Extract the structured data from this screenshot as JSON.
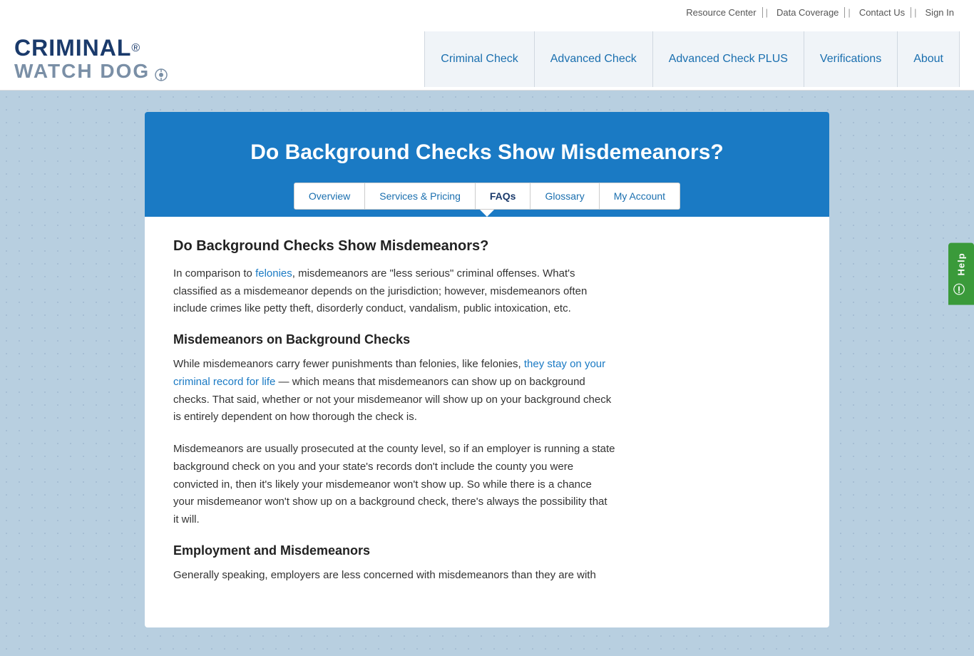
{
  "header": {
    "logo_criminal": "CRIMINAL",
    "logo_reg": "®",
    "logo_watchdog": "WATCH DOG",
    "top_links": [
      {
        "label": "Resource Center",
        "id": "resource-center"
      },
      {
        "label": "Data Coverage",
        "id": "data-coverage"
      },
      {
        "label": "Contact Us",
        "id": "contact-us"
      },
      {
        "label": "Sign In",
        "id": "sign-in"
      }
    ],
    "nav_items": [
      {
        "label": "Criminal Check",
        "id": "nav-criminal-check"
      },
      {
        "label": "Advanced Check",
        "id": "nav-advanced-check"
      },
      {
        "label": "Advanced Check PLUS",
        "id": "nav-advanced-check-plus"
      },
      {
        "label": "Verifications",
        "id": "nav-verifications"
      },
      {
        "label": "About",
        "id": "nav-about"
      }
    ]
  },
  "hero": {
    "title": "Do Background Checks Show Misdemeanors?"
  },
  "sub_nav": {
    "items": [
      {
        "label": "Overview",
        "id": "tab-overview",
        "active": false
      },
      {
        "label": "Services & Pricing",
        "id": "tab-services",
        "active": false
      },
      {
        "label": "FAQs",
        "id": "tab-faqs",
        "active": true
      },
      {
        "label": "Glossary",
        "id": "tab-glossary",
        "active": false
      },
      {
        "label": "My Account",
        "id": "tab-my-account",
        "active": false
      }
    ]
  },
  "content": {
    "section1": {
      "heading": "Do Background Checks Show Misdemeanors?",
      "paragraph": "In comparison to felonies, misdemeanors are \"less serious\" criminal offenses. What's classified as a misdemeanor depends on the jurisdiction; however, misdemeanors often include crimes like petty theft, disorderly conduct, vandalism, public intoxication, etc.",
      "link_felonies": "felonies"
    },
    "section2": {
      "heading": "Misdemeanors on Background Checks",
      "paragraph1_pre": "While misdemeanors carry fewer punishments than felonies, like felonies, ",
      "paragraph1_link": "they stay on your criminal record for life",
      "paragraph1_post": " — which means that misdemeanors can show up on background checks. That said, whether or not your misdemeanor will show up on your background check is entirely dependent on how thorough the check is.",
      "paragraph2": "Misdemeanors are usually prosecuted at the county level, so if an employer is running a state background check on you and your state's records don't include the county you were convicted in, then it's likely your misdemeanor won't show up. So while there is a chance your misdemeanor won't show up on a background check, there's always the possibility that it will."
    },
    "section3": {
      "heading": "Employment and Misdemeanors",
      "paragraph": "Generally speaking, employers are less concerned with misdemeanors than they are with"
    }
  },
  "help_button": {
    "label": "Help",
    "icon": "?"
  }
}
